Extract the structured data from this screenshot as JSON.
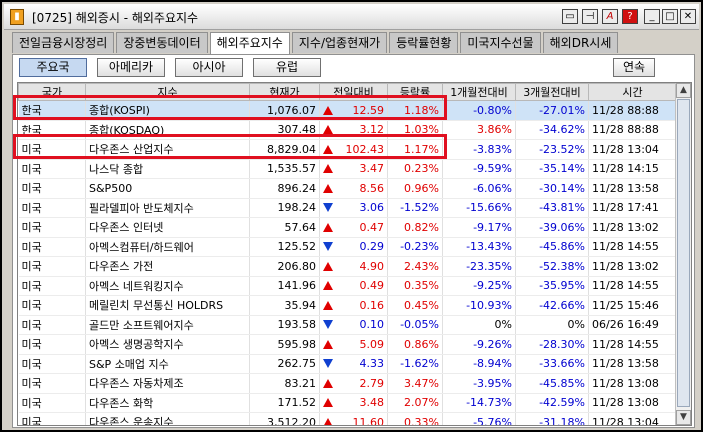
{
  "window": {
    "title": "[0725] 해외증시 - 해외주요지수"
  },
  "titlebar_buttons": [
    "restore-icon",
    "pin-icon",
    "font-icon",
    "help-icon",
    "minimize-icon",
    "maximize-icon",
    "close-icon"
  ],
  "tabs": [
    "전일금융시장정리",
    "장중변동데이터",
    "해외주요지수",
    "지수/업종현재가",
    "등락률현황",
    "미국지수선물",
    "해외DR시세"
  ],
  "active_tab": 2,
  "region_buttons": [
    "주요국",
    "아메리카",
    "아시아",
    "유럽"
  ],
  "active_region": 0,
  "continuous_button": "연속",
  "columns": [
    "국가",
    "지수",
    "현재가",
    "전일대비",
    "등락률",
    "1개월전대비",
    "3개월전대비",
    "시간"
  ],
  "colors": {
    "up": "#e00000",
    "down": "#0000d0",
    "selected_row": "#cfe3f7",
    "highlight": "#e01020"
  },
  "rows": [
    {
      "country": "한국",
      "index": "종합(KOSPI)",
      "price": "1,076.07",
      "dir": "up",
      "change": "12.59",
      "rate": "1.18%",
      "m1": "-0.80%",
      "m3": "-27.01%",
      "time": "11/28 88:88"
    },
    {
      "country": "한국",
      "index": "종합(KOSDAQ)",
      "price": "307.48",
      "dir": "up",
      "change": "3.12",
      "rate": "1.03%",
      "m1": "3.86%",
      "m3": "-34.62%",
      "time": "11/28 88:88"
    },
    {
      "country": "미국",
      "index": "다우존스 산업지수",
      "price": "8,829.04",
      "dir": "up",
      "change": "102.43",
      "rate": "1.17%",
      "m1": "-3.83%",
      "m3": "-23.52%",
      "time": "11/28 13:04"
    },
    {
      "country": "미국",
      "index": "나스닥 종합",
      "price": "1,535.57",
      "dir": "up",
      "change": "3.47",
      "rate": "0.23%",
      "m1": "-9.59%",
      "m3": "-35.14%",
      "time": "11/28 14:15"
    },
    {
      "country": "미국",
      "index": "S&P500",
      "price": "896.24",
      "dir": "up",
      "change": "8.56",
      "rate": "0.96%",
      "m1": "-6.06%",
      "m3": "-30.14%",
      "time": "11/28 13:58"
    },
    {
      "country": "미국",
      "index": "필라델피아 반도체지수",
      "price": "198.24",
      "dir": "down",
      "change": "3.06",
      "rate": "-1.52%",
      "m1": "-15.66%",
      "m3": "-43.81%",
      "time": "11/28 17:41"
    },
    {
      "country": "미국",
      "index": "다우존스 인터넷",
      "price": "57.64",
      "dir": "up",
      "change": "0.47",
      "rate": "0.82%",
      "m1": "-9.17%",
      "m3": "-39.06%",
      "time": "11/28 13:02"
    },
    {
      "country": "미국",
      "index": "아멕스컴퓨터/하드웨어",
      "price": "125.52",
      "dir": "down",
      "change": "0.29",
      "rate": "-0.23%",
      "m1": "-13.43%",
      "m3": "-45.86%",
      "time": "11/28 14:55"
    },
    {
      "country": "미국",
      "index": "다우존스 가전",
      "price": "206.80",
      "dir": "up",
      "change": "4.90",
      "rate": "2.43%",
      "m1": "-23.35%",
      "m3": "-52.38%",
      "time": "11/28 13:02"
    },
    {
      "country": "미국",
      "index": "아멕스 네트워킹지수",
      "price": "141.96",
      "dir": "up",
      "change": "0.49",
      "rate": "0.35%",
      "m1": "-9.25%",
      "m3": "-35.95%",
      "time": "11/28 14:55"
    },
    {
      "country": "미국",
      "index": "메릴린치 무선통신 HOLDRS",
      "price": "35.94",
      "dir": "up",
      "change": "0.16",
      "rate": "0.45%",
      "m1": "-10.93%",
      "m3": "-42.66%",
      "time": "11/25 15:46"
    },
    {
      "country": "미국",
      "index": "골드만 소프트웨어지수",
      "price": "193.58",
      "dir": "down",
      "change": "0.10",
      "rate": "-0.05%",
      "m1": "0%",
      "m3": "0%",
      "time": "06/26 16:49"
    },
    {
      "country": "미국",
      "index": "아멕스 생명공학지수",
      "price": "595.98",
      "dir": "up",
      "change": "5.09",
      "rate": "0.86%",
      "m1": "-9.26%",
      "m3": "-28.30%",
      "time": "11/28 14:55"
    },
    {
      "country": "미국",
      "index": "S&P 소매업 지수",
      "price": "262.75",
      "dir": "down",
      "change": "4.33",
      "rate": "-1.62%",
      "m1": "-8.94%",
      "m3": "-33.66%",
      "time": "11/28 13:58"
    },
    {
      "country": "미국",
      "index": "다우존스 자동차제조",
      "price": "83.21",
      "dir": "up",
      "change": "2.79",
      "rate": "3.47%",
      "m1": "-3.95%",
      "m3": "-45.85%",
      "time": "11/28 13:08"
    },
    {
      "country": "미국",
      "index": "다우존스 화학",
      "price": "171.52",
      "dir": "up",
      "change": "3.48",
      "rate": "2.07%",
      "m1": "-14.73%",
      "m3": "-42.59%",
      "time": "11/28 13:08"
    },
    {
      "country": "미국",
      "index": "다우존스 운송지수",
      "price": "3,512.20",
      "dir": "up",
      "change": "11.60",
      "rate": "0.33%",
      "m1": "-5.76%",
      "m3": "-31.18%",
      "time": "11/28 13:04"
    }
  ]
}
